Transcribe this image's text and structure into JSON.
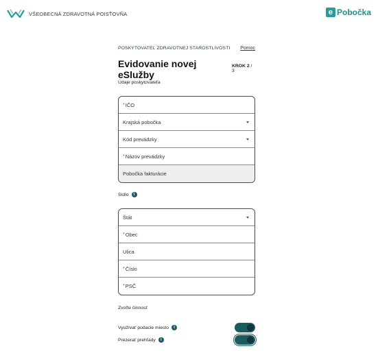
{
  "header": {
    "brand_name": "VŠEOBECNÁ ZDRAVOTNÁ POISŤOVŇA",
    "product_badge": "e",
    "product_name": "Pobočka"
  },
  "form": {
    "provider_label": "POSKYTOVATEĽ ZDRAVOTNEJ STAROSTLIVOSTI",
    "help_link": "Pomoc",
    "title": "Evidovanie novej eSlužby",
    "step_prefix": "KROK 2",
    "step_suffix": " / 3"
  },
  "provider_section": {
    "label": "Údaje poskytovateľa",
    "fields": [
      {
        "label": "IČO",
        "required": "*"
      },
      {
        "label": "Krajská pobočka"
      },
      {
        "label": "Kód prevádzky"
      },
      {
        "label": "Názov prevádzky",
        "required": "*"
      },
      {
        "label": "Pobočka fakturácie"
      }
    ]
  },
  "address_section": {
    "label": "Sídlo",
    "info_icon": "i",
    "fields": [
      {
        "label": "Štát"
      },
      {
        "label": "Obec",
        "required": "*"
      },
      {
        "label": "Ulica"
      },
      {
        "label": "Číslo",
        "required": "*"
      },
      {
        "label": "PSČ",
        "required": "*"
      }
    ]
  },
  "activity_section": {
    "label": "Zvoľte činnosť",
    "toggles": [
      {
        "label": "Využívať podacie miesto",
        "on": true,
        "info_icon": "i"
      },
      {
        "label": "Prezerať prehľady",
        "on": true,
        "info_icon": "i"
      }
    ]
  },
  "colors": {
    "accent": "#1f8f8d",
    "toggle_on": "#1c5a5f",
    "required": "#c0392b"
  }
}
